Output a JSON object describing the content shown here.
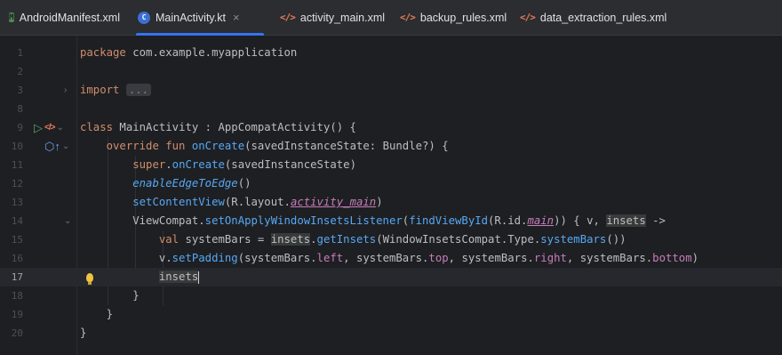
{
  "tabs": [
    {
      "label": "AndroidManifest.xml",
      "icon": "manifest-icon",
      "active": false
    },
    {
      "label": "MainActivity.kt",
      "icon": "kotlin-class-icon",
      "active": true
    },
    {
      "label": "activity_main.xml",
      "icon": "xml-icon",
      "active": false
    },
    {
      "label": "backup_rules.xml",
      "icon": "xml-icon",
      "active": false
    },
    {
      "label": "data_extraction_rules.xml",
      "icon": "xml-icon",
      "active": false
    }
  ],
  "tab_close_glyph": "×",
  "icon_glyphs": {
    "manifest": "M",
    "kotlin": "C",
    "xml": "</>"
  },
  "colors": {
    "accent": "#3574f0",
    "background": "#1e1f22",
    "keyword": "#cf8e6d",
    "function": "#56a8f5",
    "property": "#c77dbb",
    "text": "#bcbec4"
  },
  "editor": {
    "current_line": "17",
    "lines": [
      {
        "num": "1",
        "tokens": [
          {
            "t": "kw",
            "v": "package"
          },
          {
            "t": "p",
            "v": " com.example.myapplication"
          }
        ]
      },
      {
        "num": "2",
        "tokens": []
      },
      {
        "num": "3",
        "tokens": [
          {
            "t": "kw",
            "v": "import"
          },
          {
            "t": "p",
            "v": " "
          },
          {
            "t": "fold",
            "v": "..."
          }
        ]
      },
      {
        "num": "8",
        "tokens": []
      },
      {
        "num": "9",
        "tokens": [
          {
            "t": "kw",
            "v": "class"
          },
          {
            "t": "p",
            "v": " MainActivity : AppCompatActivity() {"
          }
        ]
      },
      {
        "num": "10",
        "tokens": [
          {
            "t": "p",
            "v": "    "
          },
          {
            "t": "kw",
            "v": "override fun"
          },
          {
            "t": "p",
            "v": " "
          },
          {
            "t": "fn",
            "v": "onCreate"
          },
          {
            "t": "p",
            "v": "(savedInstanceState: Bundle?) {"
          }
        ]
      },
      {
        "num": "11",
        "tokens": [
          {
            "t": "p",
            "v": "        "
          },
          {
            "t": "kw",
            "v": "super"
          },
          {
            "t": "p",
            "v": "."
          },
          {
            "t": "fn",
            "v": "onCreate"
          },
          {
            "t": "p",
            "v": "(savedInstanceState)"
          }
        ]
      },
      {
        "num": "12",
        "tokens": [
          {
            "t": "p",
            "v": "        "
          },
          {
            "t": "it",
            "v": "enableEdgeToEdge"
          },
          {
            "t": "p",
            "v": "()"
          }
        ]
      },
      {
        "num": "13",
        "tokens": [
          {
            "t": "p",
            "v": "        "
          },
          {
            "t": "fn",
            "v": "setContentView"
          },
          {
            "t": "p",
            "v": "(R.layout."
          },
          {
            "t": "propu",
            "v": "activity_main"
          },
          {
            "t": "p",
            "v": ")"
          }
        ]
      },
      {
        "num": "14",
        "tokens": [
          {
            "t": "p",
            "v": "        ViewCompat."
          },
          {
            "t": "fn",
            "v": "setOnApplyWindowInsetsListener"
          },
          {
            "t": "p",
            "v": "("
          },
          {
            "t": "fn",
            "v": "findViewById"
          },
          {
            "t": "p",
            "v": "(R.id."
          },
          {
            "t": "propu",
            "v": "main"
          },
          {
            "t": "p",
            "v": ")) { v, "
          },
          {
            "t": "hl",
            "v": "insets"
          },
          {
            "t": "p",
            "v": " ->"
          }
        ]
      },
      {
        "num": "15",
        "tokens": [
          {
            "t": "p",
            "v": "            "
          },
          {
            "t": "kw",
            "v": "val"
          },
          {
            "t": "p",
            "v": " systemBars = "
          },
          {
            "t": "hl",
            "v": "insets"
          },
          {
            "t": "p",
            "v": "."
          },
          {
            "t": "fn",
            "v": "getInsets"
          },
          {
            "t": "p",
            "v": "(WindowInsetsCompat.Type."
          },
          {
            "t": "fn",
            "v": "systemBars"
          },
          {
            "t": "p",
            "v": "())"
          }
        ]
      },
      {
        "num": "16",
        "tokens": [
          {
            "t": "p",
            "v": "            v."
          },
          {
            "t": "fn",
            "v": "setPadding"
          },
          {
            "t": "p",
            "v": "(systemBars."
          },
          {
            "t": "prop",
            "v": "left"
          },
          {
            "t": "p",
            "v": ", systemBars."
          },
          {
            "t": "prop",
            "v": "top"
          },
          {
            "t": "p",
            "v": ", systemBars."
          },
          {
            "t": "prop",
            "v": "right"
          },
          {
            "t": "p",
            "v": ", systemBars."
          },
          {
            "t": "prop",
            "v": "bottom"
          },
          {
            "t": "p",
            "v": ")"
          }
        ]
      },
      {
        "num": "17",
        "tokens": [
          {
            "t": "p",
            "v": "            "
          },
          {
            "t": "hl",
            "v": "insets"
          },
          {
            "t": "caret",
            "v": ""
          }
        ]
      },
      {
        "num": "18",
        "tokens": [
          {
            "t": "p",
            "v": "        }"
          }
        ]
      },
      {
        "num": "19",
        "tokens": [
          {
            "t": "p",
            "v": "    }"
          }
        ]
      },
      {
        "num": "20",
        "tokens": [
          {
            "t": "p",
            "v": "}"
          }
        ]
      }
    ],
    "gutter": {
      "3": {
        "fold": "›"
      },
      "9": {
        "run": "▷",
        "cls": "</>",
        "fold": "⌄"
      },
      "10": {
        "ovr": "⬡↑",
        "fold": "⌄"
      },
      "14": {
        "fold": "⌄"
      },
      "17": {
        "bulb": true
      }
    }
  }
}
